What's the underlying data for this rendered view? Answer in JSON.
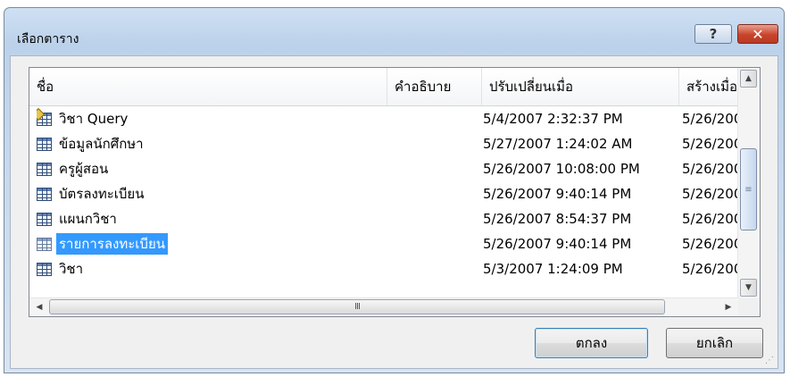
{
  "dialog": {
    "title": "เลือกตาราง",
    "help_glyph": "?",
    "close_glyph": "✕"
  },
  "columns": [
    "ชื่อ",
    "คำอธิบาย",
    "ปรับเปลี่ยนเมื่อ",
    "สร้างเมื่อ"
  ],
  "rows": [
    {
      "name": "วิชา Query",
      "modified": "5/4/2007 2:32:37 PM",
      "created": "5/26/200",
      "icon": "query-icon"
    },
    {
      "name": "ข้อมูลนักศึกษา",
      "modified": "5/27/2007 1:24:02 AM",
      "created": "5/26/200",
      "icon": "table-icon"
    },
    {
      "name": "ครูผู้สอน",
      "modified": "5/26/2007 10:08:00 PM",
      "created": "5/26/200",
      "icon": "table-icon"
    },
    {
      "name": "บัตรลงทะเบียน",
      "modified": "5/26/2007 9:40:14 PM",
      "created": "5/26/200",
      "icon": "table-icon"
    },
    {
      "name": "แผนกวิชา",
      "modified": "5/26/2007 8:54:37 PM",
      "created": "5/26/200",
      "icon": "table-icon"
    },
    {
      "name": "รายการลงทะเบียน",
      "modified": "5/26/2007 9:40:14 PM",
      "created": "5/26/200",
      "icon": "table-icon",
      "selected": true
    },
    {
      "name": "วิชา",
      "modified": "5/3/2007 1:24:09 PM",
      "created": "5/26/200",
      "icon": "table-icon"
    }
  ],
  "scrollbar": {
    "up": "▲",
    "down": "▼",
    "left": "◀",
    "right": "▶",
    "h_thumb_grip": "III",
    "v_thumb_grip": "≡"
  },
  "buttons": {
    "ok": "ตกลง",
    "cancel": "ยกเลิก"
  },
  "colors": {
    "selection": "#3399ff",
    "close_button": "#c8442c"
  }
}
